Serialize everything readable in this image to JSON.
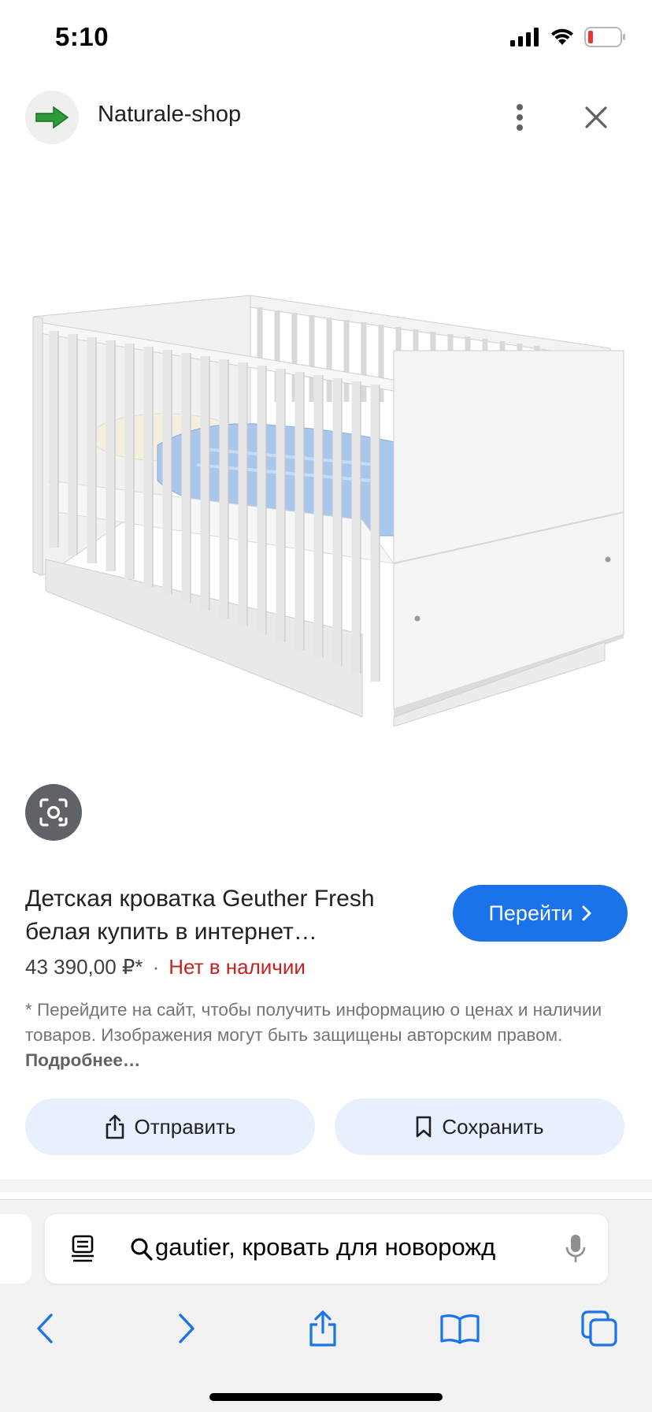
{
  "status_bar": {
    "time": "5:10"
  },
  "header": {
    "site_name": "Naturale-shop"
  },
  "product": {
    "title": "Детская кроватка Geuther Fresh белая купить в интернет…",
    "price": "43 390,00 ₽*",
    "separator": "·",
    "availability": "Нет в наличии",
    "visit_label": "Перейти",
    "disclaimer": "* Перейдите на сайт, чтобы получить информацию о ценах и наличии товаров. Изображения могут быть защищены авторским правом.",
    "more_label": "Подробнее…"
  },
  "actions": {
    "share_label": "Отправить",
    "save_label": "Сохранить"
  },
  "safari": {
    "address_text": "gautier, кровать для новорожд"
  },
  "colors": {
    "accent": "#1a73e8",
    "unavailable": "#c5221f",
    "action_bg": "#e8f0fe"
  },
  "icons": [
    "signal-icon",
    "wifi-icon",
    "battery-icon",
    "arrow-favicon-icon",
    "more-vert-icon",
    "close-icon",
    "lens-icon",
    "chevron-right-icon",
    "share-icon",
    "bookmark-icon",
    "reader-icon",
    "search-icon",
    "mic-icon",
    "back-icon",
    "forward-icon",
    "safari-share-icon",
    "bookmarks-icon",
    "tabs-icon"
  ]
}
